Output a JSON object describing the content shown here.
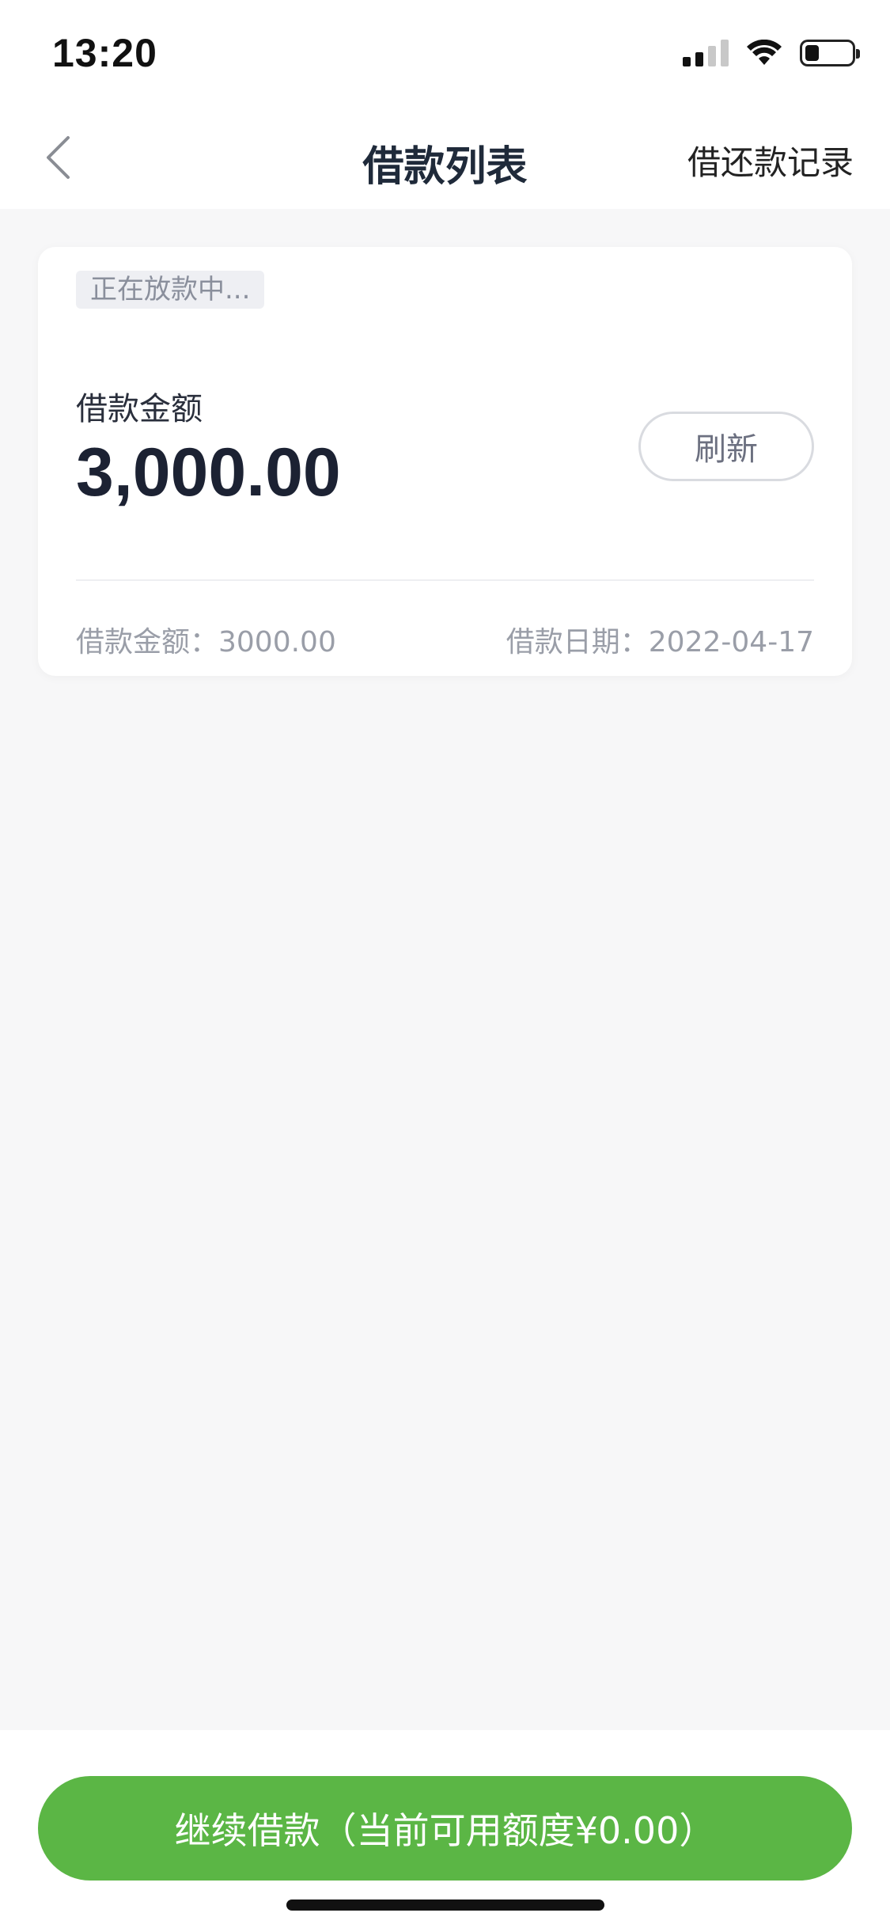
{
  "status_bar": {
    "time": "13:20",
    "icons": [
      "signal-icon",
      "wifi-icon",
      "battery-icon"
    ],
    "battery_level": 0.3
  },
  "nav": {
    "back_icon": "chevron-left-icon",
    "title": "借款列表",
    "action": "借还款记录"
  },
  "loan": {
    "status": "正在放款中...",
    "amount_label": "借款金额",
    "amount": "3,000.00",
    "refresh_label": "刷新",
    "detail_amount": "借款金额：3000.00",
    "detail_date": "借款日期：2022-04-17"
  },
  "footer": {
    "continue_label": "继续借款（当前可用额度¥0.00）"
  },
  "colors": {
    "accent": "#5bb645",
    "background": "#f7f7f8",
    "card": "#ffffff"
  }
}
